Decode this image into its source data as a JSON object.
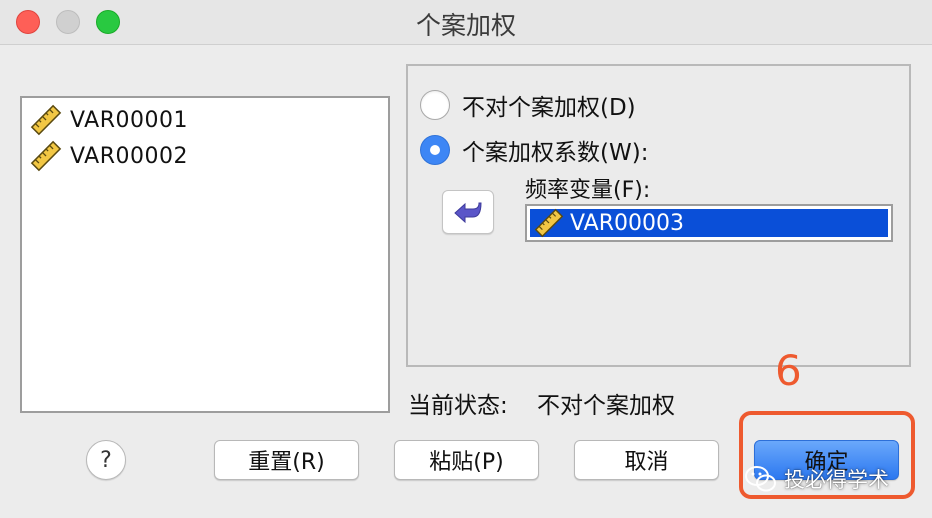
{
  "window": {
    "title": "个案加权"
  },
  "variables": [
    {
      "name": "VAR00001",
      "icon": "ruler-icon"
    },
    {
      "name": "VAR00002",
      "icon": "ruler-icon"
    }
  ],
  "weighting": {
    "option_none_label": "不对个案加权(D)",
    "option_weight_label": "个案加权系数(W):",
    "selected_option": "weight",
    "frequency_label": "频率变量(F):",
    "frequency_variable": "VAR00003",
    "move_icon": "arrow-left-icon"
  },
  "status": {
    "label": "当前状态:",
    "value": "不对个案加权"
  },
  "buttons": {
    "help": "?",
    "reset": "重置(R)",
    "paste": "粘贴(P)",
    "cancel": "取消",
    "ok": "确定"
  },
  "annotation": {
    "step_number": "6"
  },
  "watermark": {
    "text": "投必得学术"
  },
  "colors": {
    "selection": "#0a4fd8",
    "radio_selected": "#3d86f5",
    "annotation": "#ee5a2f",
    "primary_button": "#2c78f0"
  }
}
